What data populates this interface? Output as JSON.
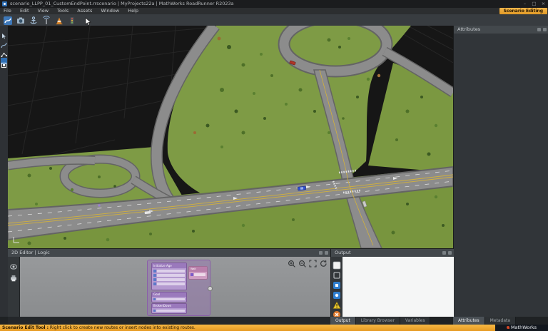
{
  "window": {
    "title": "scenario_LLPP_01_CustomEndPoint.rrscenario | MyProjects22a | MathWorks RoadRunner R2023a",
    "mode_badge": "Scenario Editing",
    "controls": {
      "minimize": "–",
      "maximize": "□",
      "close": "×"
    }
  },
  "menu": {
    "items": [
      "File",
      "Edit",
      "View",
      "Tools",
      "Assets",
      "Window",
      "Help"
    ]
  },
  "attributes_panel": {
    "title": "Attributes",
    "tabs": {
      "attributes": "Attributes",
      "metadata": "Metadata"
    }
  },
  "editor2d_panel": {
    "title": "2D Editor | Logic",
    "nodes": {
      "init": "Initialize Age",
      "wait": "Wait",
      "goal": "Goal",
      "broken": "BrokenDown"
    }
  },
  "output_panel": {
    "title": "Output",
    "tabs": {
      "output": "Output",
      "library": "Library Browser",
      "variables": "Variables"
    }
  },
  "statusbar": {
    "tool_name": "Scenario Edit Tool :",
    "message": "Right click to create new routes or insert nodes into existing routes.",
    "brand": "MathWorks"
  },
  "colors": {
    "accent_orange": "#e9a63c",
    "selection_blue": "#2f6fb4",
    "grass": "#7e9b45",
    "road": "#8c8c8c",
    "lane_yellow": "#d2b13c"
  }
}
